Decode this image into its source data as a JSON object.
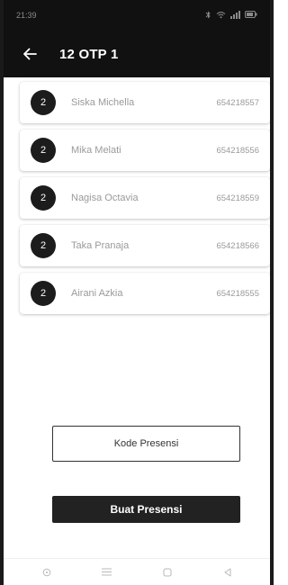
{
  "status_bar": {
    "time": "21:39",
    "icons": [
      "bluetooth-icon",
      "wifi-icon",
      "signal-icon",
      "battery-icon"
    ]
  },
  "app_bar": {
    "title": "12 OTP 1",
    "back_icon": "arrow-left-icon",
    "background": "#111111"
  },
  "students": [
    {
      "badge": "2",
      "name": "Siska Michella",
      "nim": "654218557"
    },
    {
      "badge": "2",
      "name": "Mika Melati",
      "nim": "654218556"
    },
    {
      "badge": "2",
      "name": "Nagisa Octavia",
      "nim": "654218559"
    },
    {
      "badge": "2",
      "name": "Taka Pranaja",
      "nim": "654218566"
    },
    {
      "badge": "2",
      "name": "Airani Azkia",
      "nim": "654218555"
    }
  ],
  "buttons": {
    "kode_presensi": "Kode Presensi",
    "buat_presensi": "Buat Presensi"
  },
  "nav_bar": {
    "icons": [
      "circle-icon",
      "menu-icon",
      "square-icon",
      "back-triangle-icon"
    ]
  },
  "colors": {
    "accent": "#222222",
    "text_muted": "#9a9a9a"
  }
}
